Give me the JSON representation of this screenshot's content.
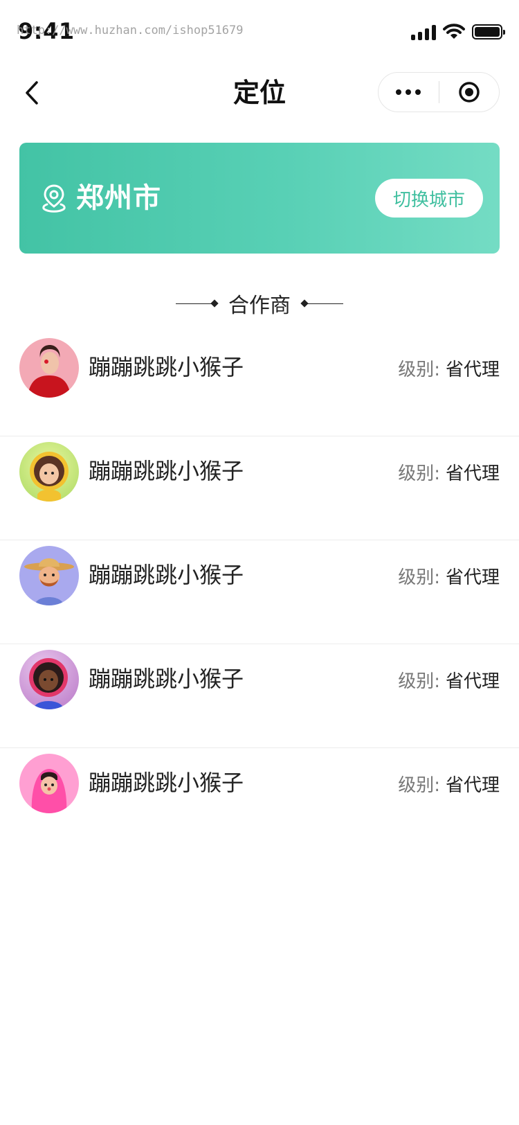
{
  "status_bar": {
    "time": "9:41",
    "watermark": "http://www.huzhan.com/ishop51679"
  },
  "nav": {
    "title": "定位"
  },
  "city_banner": {
    "city": "郑州市",
    "switch_label": "切换城市",
    "gradient_start": "#43c3a5",
    "gradient_end": "#74dcc4"
  },
  "section": {
    "title": "合作商"
  },
  "partners": [
    {
      "name": "蹦蹦跳跳小猴子",
      "level_label": "级别:",
      "level": "省代理",
      "avatar": "woman-red-dress-avatar"
    },
    {
      "name": "蹦蹦跳跳小猴子",
      "level_label": "级别:",
      "level": "省代理",
      "avatar": "astronaut-girl-avatar"
    },
    {
      "name": "蹦蹦跳跳小猴子",
      "level_label": "级别:",
      "level": "省代理",
      "avatar": "farmer-hat-avatar"
    },
    {
      "name": "蹦蹦跳跳小猴子",
      "level_label": "级别:",
      "level": "省代理",
      "avatar": "astronaut-helmet-avatar"
    },
    {
      "name": "蹦蹦跳跳小猴子",
      "level_label": "级别:",
      "level": "省代理",
      "avatar": "pink-hood-avatar"
    }
  ],
  "colors": {
    "accent": "#43c3a5",
    "switch_text": "#3fbf9f"
  }
}
